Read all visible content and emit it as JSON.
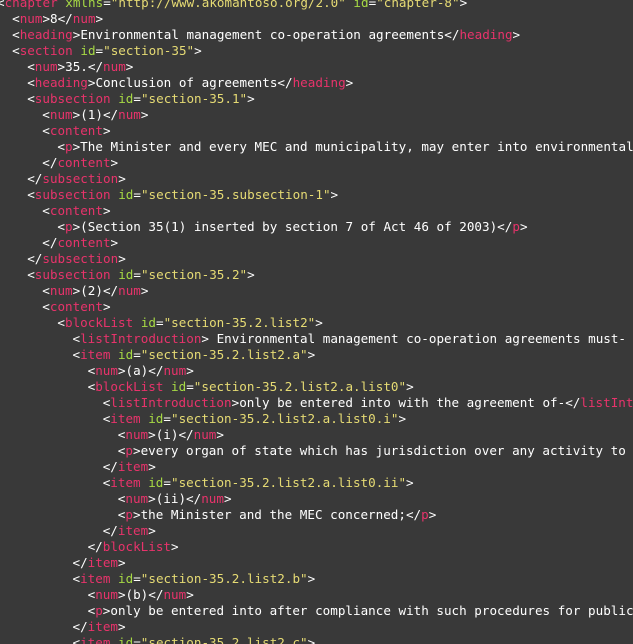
{
  "colors": {
    "background": "#393939",
    "tag": "#e8336b",
    "attribute": "#a6d944",
    "string": "#e6db74",
    "text": "#ffffff"
  },
  "lines": [
    {
      "indent": 0,
      "tokens": [
        [
          "p",
          "<"
        ],
        [
          "tag",
          "chapter"
        ],
        [
          "p",
          " "
        ],
        [
          "attr",
          "xmlns"
        ],
        [
          "p",
          "="
        ],
        [
          "str",
          "\"http://www.akomantoso.org/2.0\""
        ],
        [
          "p",
          " "
        ],
        [
          "attr",
          "id"
        ],
        [
          "p",
          "="
        ],
        [
          "str",
          "\"chapter-8\""
        ],
        [
          "p",
          ">"
        ]
      ]
    },
    {
      "indent": 1,
      "tokens": [
        [
          "p",
          "<"
        ],
        [
          "tag",
          "num"
        ],
        [
          "p",
          ">8</"
        ],
        [
          "tag",
          "num"
        ],
        [
          "p",
          ">"
        ]
      ]
    },
    {
      "indent": 1,
      "tokens": [
        [
          "p",
          "<"
        ],
        [
          "tag",
          "heading"
        ],
        [
          "p",
          ">Environmental management co-operation agreements</"
        ],
        [
          "tag",
          "heading"
        ],
        [
          "p",
          ">"
        ]
      ]
    },
    {
      "indent": 1,
      "tokens": [
        [
          "p",
          "<"
        ],
        [
          "tag",
          "section"
        ],
        [
          "p",
          " "
        ],
        [
          "attr",
          "id"
        ],
        [
          "p",
          "="
        ],
        [
          "str",
          "\"section-35\""
        ],
        [
          "p",
          ">"
        ]
      ]
    },
    {
      "indent": 2,
      "tokens": [
        [
          "p",
          "<"
        ],
        [
          "tag",
          "num"
        ],
        [
          "p",
          ">35.</"
        ],
        [
          "tag",
          "num"
        ],
        [
          "p",
          ">"
        ]
      ]
    },
    {
      "indent": 2,
      "tokens": [
        [
          "p",
          "<"
        ],
        [
          "tag",
          "heading"
        ],
        [
          "p",
          ">Conclusion of agreements</"
        ],
        [
          "tag",
          "heading"
        ],
        [
          "p",
          ">"
        ]
      ]
    },
    {
      "indent": 2,
      "tokens": [
        [
          "p",
          "<"
        ],
        [
          "tag",
          "subsection"
        ],
        [
          "p",
          " "
        ],
        [
          "attr",
          "id"
        ],
        [
          "p",
          "="
        ],
        [
          "str",
          "\"section-35.1\""
        ],
        [
          "p",
          ">"
        ]
      ]
    },
    {
      "indent": 3,
      "tokens": [
        [
          "p",
          "<"
        ],
        [
          "tag",
          "num"
        ],
        [
          "p",
          ">(1)</"
        ],
        [
          "tag",
          "num"
        ],
        [
          "p",
          ">"
        ]
      ]
    },
    {
      "indent": 3,
      "tokens": [
        [
          "p",
          "<"
        ],
        [
          "tag",
          "content"
        ],
        [
          "p",
          ">"
        ]
      ]
    },
    {
      "indent": 4,
      "tokens": [
        [
          "p",
          "<"
        ],
        [
          "tag",
          "p"
        ],
        [
          "p",
          ">The Minister and every MEC and municipality, may enter into environmental man"
        ]
      ]
    },
    {
      "indent": 3,
      "tokens": [
        [
          "p",
          "</"
        ],
        [
          "tag",
          "content"
        ],
        [
          "p",
          ">"
        ]
      ]
    },
    {
      "indent": 2,
      "tokens": [
        [
          "p",
          "</"
        ],
        [
          "tag",
          "subsection"
        ],
        [
          "p",
          ">"
        ]
      ]
    },
    {
      "indent": 2,
      "tokens": [
        [
          "p",
          "<"
        ],
        [
          "tag",
          "subsection"
        ],
        [
          "p",
          " "
        ],
        [
          "attr",
          "id"
        ],
        [
          "p",
          "="
        ],
        [
          "str",
          "\"section-35.subsection-1\""
        ],
        [
          "p",
          ">"
        ]
      ]
    },
    {
      "indent": 3,
      "tokens": [
        [
          "p",
          "<"
        ],
        [
          "tag",
          "content"
        ],
        [
          "p",
          ">"
        ]
      ]
    },
    {
      "indent": 4,
      "tokens": [
        [
          "p",
          "<"
        ],
        [
          "tag",
          "p"
        ],
        [
          "p",
          ">(Section 35(1) inserted by section 7 of Act 46 of 2003)</"
        ],
        [
          "tag",
          "p"
        ],
        [
          "p",
          ">"
        ]
      ]
    },
    {
      "indent": 3,
      "tokens": [
        [
          "p",
          "</"
        ],
        [
          "tag",
          "content"
        ],
        [
          "p",
          ">"
        ]
      ]
    },
    {
      "indent": 2,
      "tokens": [
        [
          "p",
          "</"
        ],
        [
          "tag",
          "subsection"
        ],
        [
          "p",
          ">"
        ]
      ]
    },
    {
      "indent": 2,
      "tokens": [
        [
          "p",
          "<"
        ],
        [
          "tag",
          "subsection"
        ],
        [
          "p",
          " "
        ],
        [
          "attr",
          "id"
        ],
        [
          "p",
          "="
        ],
        [
          "str",
          "\"section-35.2\""
        ],
        [
          "p",
          ">"
        ]
      ]
    },
    {
      "indent": 3,
      "tokens": [
        [
          "p",
          "<"
        ],
        [
          "tag",
          "num"
        ],
        [
          "p",
          ">(2)</"
        ],
        [
          "tag",
          "num"
        ],
        [
          "p",
          ">"
        ]
      ]
    },
    {
      "indent": 3,
      "tokens": [
        [
          "p",
          "<"
        ],
        [
          "tag",
          "content"
        ],
        [
          "p",
          ">"
        ]
      ]
    },
    {
      "indent": 4,
      "tokens": [
        [
          "p",
          "<"
        ],
        [
          "tag",
          "blockList"
        ],
        [
          "p",
          " "
        ],
        [
          "attr",
          "id"
        ],
        [
          "p",
          "="
        ],
        [
          "str",
          "\"section-35.2.list2\""
        ],
        [
          "p",
          ">"
        ]
      ]
    },
    {
      "indent": 5,
      "tokens": [
        [
          "p",
          "<"
        ],
        [
          "tag",
          "listIntroduction"
        ],
        [
          "p",
          "> Environmental management co-operation agreements must- </"
        ],
        [
          "tag",
          "li"
        ]
      ]
    },
    {
      "indent": 5,
      "tokens": [
        [
          "p",
          "<"
        ],
        [
          "tag",
          "item"
        ],
        [
          "p",
          " "
        ],
        [
          "attr",
          "id"
        ],
        [
          "p",
          "="
        ],
        [
          "str",
          "\"section-35.2.list2.a\""
        ],
        [
          "p",
          ">"
        ]
      ]
    },
    {
      "indent": 6,
      "tokens": [
        [
          "p",
          "<"
        ],
        [
          "tag",
          "num"
        ],
        [
          "p",
          ">(a)</"
        ],
        [
          "tag",
          "num"
        ],
        [
          "p",
          ">"
        ]
      ]
    },
    {
      "indent": 6,
      "tokens": [
        [
          "p",
          "<"
        ],
        [
          "tag",
          "blockList"
        ],
        [
          "p",
          " "
        ],
        [
          "attr",
          "id"
        ],
        [
          "p",
          "="
        ],
        [
          "str",
          "\"section-35.2.list2.a.list0\""
        ],
        [
          "p",
          ">"
        ]
      ]
    },
    {
      "indent": 7,
      "tokens": [
        [
          "p",
          "<"
        ],
        [
          "tag",
          "listIntroduction"
        ],
        [
          "p",
          ">only be entered into with the agreement of-</"
        ],
        [
          "tag",
          "listIntrodu"
        ]
      ]
    },
    {
      "indent": 7,
      "tokens": [
        [
          "p",
          "<"
        ],
        [
          "tag",
          "item"
        ],
        [
          "p",
          " "
        ],
        [
          "attr",
          "id"
        ],
        [
          "p",
          "="
        ],
        [
          "str",
          "\"section-35.2.list2.a.list0.i\""
        ],
        [
          "p",
          ">"
        ]
      ]
    },
    {
      "indent": 8,
      "tokens": [
        [
          "p",
          "<"
        ],
        [
          "tag",
          "num"
        ],
        [
          "p",
          ">(i)</"
        ],
        [
          "tag",
          "num"
        ],
        [
          "p",
          ">"
        ]
      ]
    },
    {
      "indent": 8,
      "tokens": [
        [
          "p",
          "<"
        ],
        [
          "tag",
          "p"
        ],
        [
          "p",
          ">every organ of state which has jurisdiction over any activity to whic"
        ]
      ]
    },
    {
      "indent": 7,
      "tokens": [
        [
          "p",
          "</"
        ],
        [
          "tag",
          "item"
        ],
        [
          "p",
          ">"
        ]
      ]
    },
    {
      "indent": 7,
      "tokens": [
        [
          "p",
          "<"
        ],
        [
          "tag",
          "item"
        ],
        [
          "p",
          " "
        ],
        [
          "attr",
          "id"
        ],
        [
          "p",
          "="
        ],
        [
          "str",
          "\"section-35.2.list2.a.list0.ii\""
        ],
        [
          "p",
          ">"
        ]
      ]
    },
    {
      "indent": 8,
      "tokens": [
        [
          "p",
          "<"
        ],
        [
          "tag",
          "num"
        ],
        [
          "p",
          ">(ii)</"
        ],
        [
          "tag",
          "num"
        ],
        [
          "p",
          ">"
        ]
      ]
    },
    {
      "indent": 8,
      "tokens": [
        [
          "p",
          "<"
        ],
        [
          "tag",
          "p"
        ],
        [
          "p",
          ">the Minister and the MEC concerned;</"
        ],
        [
          "tag",
          "p"
        ],
        [
          "p",
          ">"
        ]
      ]
    },
    {
      "indent": 7,
      "tokens": [
        [
          "p",
          "</"
        ],
        [
          "tag",
          "item"
        ],
        [
          "p",
          ">"
        ]
      ]
    },
    {
      "indent": 6,
      "tokens": [
        [
          "p",
          "</"
        ],
        [
          "tag",
          "blockList"
        ],
        [
          "p",
          ">"
        ]
      ]
    },
    {
      "indent": 5,
      "tokens": [
        [
          "p",
          "</"
        ],
        [
          "tag",
          "item"
        ],
        [
          "p",
          ">"
        ]
      ]
    },
    {
      "indent": 5,
      "tokens": [
        [
          "p",
          "<"
        ],
        [
          "tag",
          "item"
        ],
        [
          "p",
          " "
        ],
        [
          "attr",
          "id"
        ],
        [
          "p",
          "="
        ],
        [
          "str",
          "\"section-35.2.list2.b\""
        ],
        [
          "p",
          ">"
        ]
      ]
    },
    {
      "indent": 6,
      "tokens": [
        [
          "p",
          "<"
        ],
        [
          "tag",
          "num"
        ],
        [
          "p",
          ">(b)</"
        ],
        [
          "tag",
          "num"
        ],
        [
          "p",
          ">"
        ]
      ]
    },
    {
      "indent": 6,
      "tokens": [
        [
          "p",
          "<"
        ],
        [
          "tag",
          "p"
        ],
        [
          "p",
          ">only be entered into after compliance with such procedures for public par"
        ]
      ]
    },
    {
      "indent": 5,
      "tokens": [
        [
          "p",
          "</"
        ],
        [
          "tag",
          "item"
        ],
        [
          "p",
          ">"
        ]
      ]
    },
    {
      "indent": 5,
      "tokens": [
        [
          "p",
          "<"
        ],
        [
          "tag",
          "item"
        ],
        [
          "p",
          " "
        ],
        [
          "attr",
          "id"
        ],
        [
          "p",
          "="
        ],
        [
          "str",
          "\"section-35.2.list2.c\""
        ],
        [
          "p",
          ">"
        ]
      ]
    }
  ]
}
